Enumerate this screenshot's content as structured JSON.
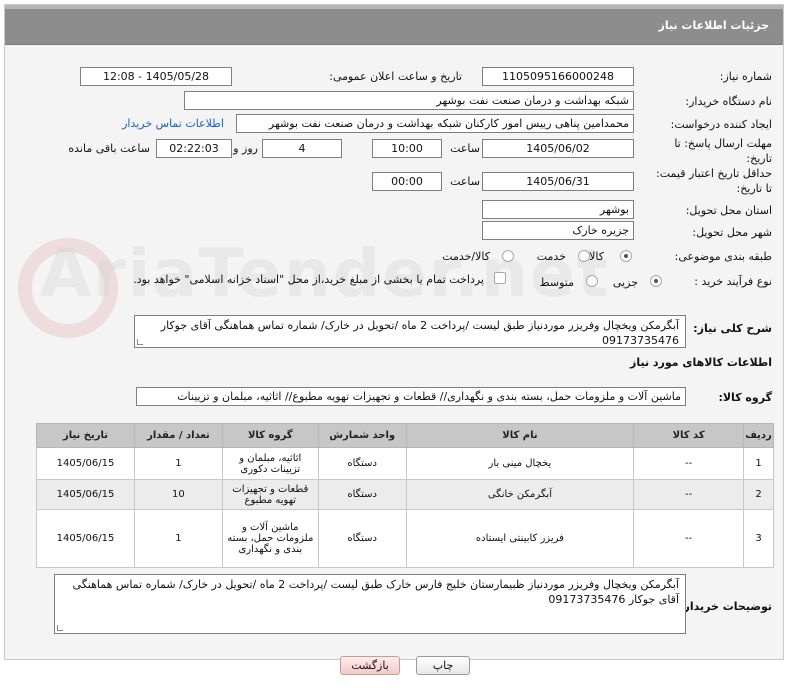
{
  "panel": {
    "title": "جزئیات اطلاعات نیاز"
  },
  "fields": {
    "need_number_label": "شماره نیاز:",
    "need_number": "1105095166000248",
    "announce_label": "تاریخ و ساعت اعلان عمومی:",
    "announce_value": "1405/05/28 - 12:08",
    "buyer_org_label": "نام دستگاه خریدار:",
    "buyer_org": "شبکه بهداشت و درمان صنعت نفت بوشهر",
    "creator_label": "ایجاد کننده درخواست:",
    "creator": "محمدامین پناهی رییس امور کارکنان شبکه بهداشت و درمان صنعت نفت بوشهر",
    "contact_link": "اطلاعات تماس خریدار",
    "reply_deadline_label_1": "مهلت ارسال پاسخ: تا",
    "reply_deadline_label_2": "تاریخ:",
    "reply_date": "1405/06/02",
    "time_label": "ساعت",
    "reply_time": "10:00",
    "days_value": "4",
    "days_label": "روز و",
    "remaining_time": "02:22:03",
    "remaining_label": "ساعت باقی مانده",
    "price_validity_label_1": "حداقل تاریخ اعتبار قیمت:",
    "price_validity_label_2": "تا تاریخ:",
    "validity_date": "1405/06/31",
    "validity_time": "00:00",
    "province_label": "استان محل تحویل:",
    "province": "بوشهر",
    "city_label": "شهر محل تحویل:",
    "city": "جزیره خارک",
    "category_label": "طبقه بندی موضوعی:",
    "category_options": [
      "کالا",
      "خدمت",
      "کالا/خدمت"
    ],
    "process_label": "نوع فرآیند خرید :",
    "process_options": [
      "جزیی",
      "متوسط"
    ],
    "payment_note": "پرداخت تمام یا بخشی از مبلغ خرید،از محل \"اسناد خزانه اسلامی\" خواهد بود."
  },
  "description": {
    "label": "شرح کلی نیاز:",
    "text": "آبگرمکن ویخچال وفریزر موردنیاز طبق لیست /پرداخت 2 ماه /تحویل در خارک/ شماره تماس هماهنگی  آقای جوکار 09173735476"
  },
  "goods_info": {
    "title": "اطلاعات کالاهای مورد نیاز"
  },
  "goods_group": {
    "label": "گروه کالا:",
    "value": "ماشین آلات و ملزومات حمل، بسته بندی و نگهداری//  قطعات و تجهیزات تهویه مطبوع// اثاثیه، مبلمان و تزیینات"
  },
  "table": {
    "headers": [
      "ردیف",
      "کد کالا",
      "نام کالا",
      "واحد شمارش",
      "گروه کالا",
      "تعداد / مقدار",
      "تاریخ نیاز"
    ],
    "rows": [
      [
        "1",
        "--",
        "یخچال مینی بار",
        "دستگاه",
        "اثاثیه، مبلمان و تزیینات دکوری",
        "1",
        "1405/06/15"
      ],
      [
        "2",
        "--",
        "آبگرمکن خانگی",
        "دستگاه",
        "قطعات و تجهیزات تهویه مطبوع",
        "10",
        "1405/06/15"
      ],
      [
        "3",
        "--",
        "فریزر کابینتی ایستاده",
        "دستگاه",
        "ماشین آلات و ملزومات حمل، بسته بندی و نگهداری",
        "1",
        "1405/06/15"
      ]
    ]
  },
  "buyer_notes": {
    "label": "توضیحات خریدار:",
    "text": "آبگرمکن ویخچال وفریزر موردنیاز ظبیمارستان خلیج فارس خارک طبق لیست /پرداخت 2 ماه /تحویل در خارک/ شماره تماس هماهنگی  آقای جوکار   09173735476"
  },
  "buttons": {
    "print": "چاپ",
    "back": "بازگشت"
  },
  "watermark": "AriaTender.net"
}
